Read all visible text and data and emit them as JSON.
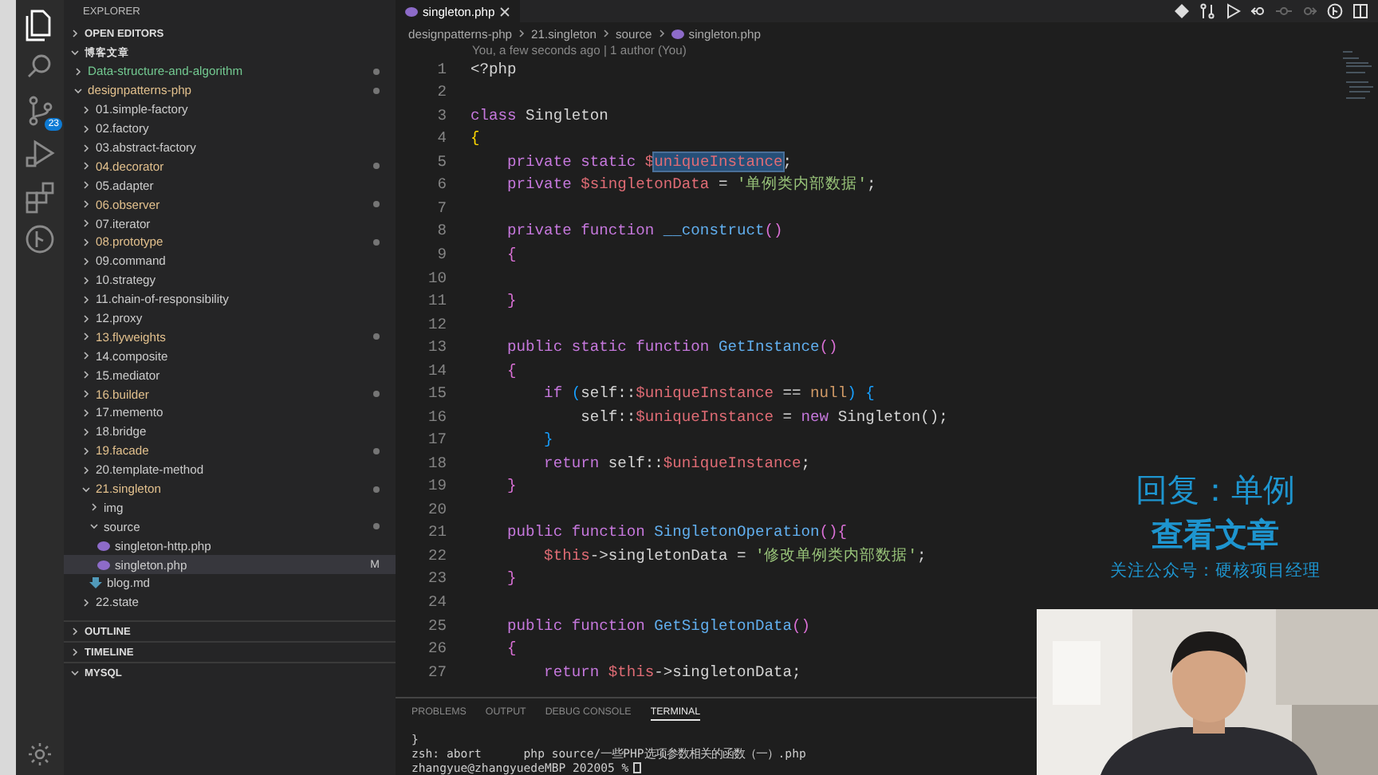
{
  "activity_bar": {
    "items": [
      {
        "kind": "files",
        "selected": true
      },
      {
        "kind": "search",
        "selected": false
      },
      {
        "kind": "source-control",
        "selected": false,
        "badge": "23"
      },
      {
        "kind": "run",
        "selected": false
      },
      {
        "kind": "extensions",
        "selected": false
      },
      {
        "kind": "git-graph",
        "selected": false
      }
    ]
  },
  "sidebar": {
    "title": "EXPLORER",
    "sections_top": [
      {
        "label": "OPEN EDITORS",
        "expanded": false
      }
    ],
    "workspace": {
      "label": "博客文章",
      "expanded": true
    },
    "tree": [
      {
        "label": "Data-structure-and-algorithm",
        "kind": "folder",
        "expanded": false,
        "color": "#73c991",
        "dot": true,
        "selected": false
      },
      {
        "label": "designpatterns-php",
        "kind": "folder",
        "expanded": true,
        "color": "#e2c08d",
        "dot": true,
        "selected": false,
        "children": [
          {
            "label": "01.simple-factory",
            "kind": "folder",
            "expanded": false,
            "color": "#cccccc",
            "dot": false,
            "selected": false
          },
          {
            "label": "02.factory",
            "kind": "folder",
            "expanded": false,
            "color": "#cccccc",
            "dot": false,
            "selected": false
          },
          {
            "label": "03.abstract-factory",
            "kind": "folder",
            "expanded": false,
            "color": "#cccccc",
            "dot": false,
            "selected": false
          },
          {
            "label": "04.decorator",
            "kind": "folder",
            "expanded": false,
            "color": "#e2c08d",
            "dot": true,
            "selected": false
          },
          {
            "label": "05.adapter",
            "kind": "folder",
            "expanded": false,
            "color": "#cccccc",
            "dot": false,
            "selected": false
          },
          {
            "label": "06.observer",
            "kind": "folder",
            "expanded": false,
            "color": "#e2c08d",
            "dot": true,
            "selected": false
          },
          {
            "label": "07.iterator",
            "kind": "folder",
            "expanded": false,
            "color": "#cccccc",
            "dot": false,
            "selected": false
          },
          {
            "label": "08.prototype",
            "kind": "folder",
            "expanded": false,
            "color": "#e2c08d",
            "dot": true,
            "selected": false
          },
          {
            "label": "09.command",
            "kind": "folder",
            "expanded": false,
            "color": "#cccccc",
            "dot": false,
            "selected": false
          },
          {
            "label": "10.strategy",
            "kind": "folder",
            "expanded": false,
            "color": "#cccccc",
            "dot": false,
            "selected": false
          },
          {
            "label": "11.chain-of-responsibility",
            "kind": "folder",
            "expanded": false,
            "color": "#cccccc",
            "dot": false,
            "selected": false
          },
          {
            "label": "12.proxy",
            "kind": "folder",
            "expanded": false,
            "color": "#cccccc",
            "dot": false,
            "selected": false
          },
          {
            "label": "13.flyweights",
            "kind": "folder",
            "expanded": false,
            "color": "#e2c08d",
            "dot": true,
            "selected": false
          },
          {
            "label": "14.composite",
            "kind": "folder",
            "expanded": false,
            "color": "#cccccc",
            "dot": false,
            "selected": false
          },
          {
            "label": "15.mediator",
            "kind": "folder",
            "expanded": false,
            "color": "#cccccc",
            "dot": false,
            "selected": false
          },
          {
            "label": "16.builder",
            "kind": "folder",
            "expanded": false,
            "color": "#e2c08d",
            "dot": true,
            "selected": false
          },
          {
            "label": "17.memento",
            "kind": "folder",
            "expanded": false,
            "color": "#cccccc",
            "dot": false,
            "selected": false
          },
          {
            "label": "18.bridge",
            "kind": "folder",
            "expanded": false,
            "color": "#cccccc",
            "dot": false,
            "selected": false
          },
          {
            "label": "19.facade",
            "kind": "folder",
            "expanded": false,
            "color": "#e2c08d",
            "dot": true,
            "selected": false
          },
          {
            "label": "20.template-method",
            "kind": "folder",
            "expanded": false,
            "color": "#cccccc",
            "dot": false,
            "selected": false
          },
          {
            "label": "21.singleton",
            "kind": "folder",
            "expanded": true,
            "color": "#e2c08d",
            "dot": true,
            "selected": false,
            "children": [
              {
                "label": "img",
                "kind": "folder",
                "expanded": false,
                "color": "#cccccc",
                "dot": false,
                "selected": false
              },
              {
                "label": "source",
                "kind": "folder",
                "expanded": true,
                "color": "#cccccc",
                "dot": true,
                "selected": false,
                "children": [
                  {
                    "label": "singleton-http.php",
                    "kind": "php_file",
                    "color": "#cccccc",
                    "dot": false,
                    "selected": false
                  },
                  {
                    "label": "singleton.php",
                    "kind": "php_file",
                    "color": "#cccccc",
                    "badge": "M",
                    "selected": true
                  }
                ]
              },
              {
                "label": "blog.md",
                "kind": "md_file",
                "color": "#cccccc",
                "dot": false,
                "selected": false
              }
            ]
          },
          {
            "label": "22.state",
            "kind": "folder",
            "expanded": false,
            "color": "#cccccc",
            "dot": false,
            "selected": false
          }
        ]
      }
    ],
    "sections_bottom": [
      {
        "label": "OUTLINE",
        "expanded": false
      },
      {
        "label": "TIMELINE",
        "expanded": false
      },
      {
        "label": "MYSQL",
        "expanded": true
      }
    ]
  },
  "editor": {
    "tabs": [
      {
        "label": "singleton.php",
        "selected": true
      }
    ],
    "breadcrumbs": [
      "designpatterns-php",
      "21.singleton",
      "source",
      "singleton.php"
    ],
    "blame": "You, a few seconds ago | 1 author (You)",
    "lines": [
      {
        "number": "1",
        "tokens": [
          {
            "text": "<?php",
            "kind": "plain"
          }
        ]
      },
      {
        "number": "2"
      },
      {
        "number": "3",
        "tokens": [
          {
            "text": "class",
            "kind": "keyword"
          },
          {
            "text": " Singleton",
            "kind": "plain"
          }
        ]
      },
      {
        "number": "4",
        "tokens": [
          {
            "text": "{",
            "kind": "brace"
          }
        ]
      },
      {
        "number": "5",
        "tokens": [
          {
            "text": "    private static ",
            "kind": "keyword"
          },
          {
            "text": "$",
            "kind": "variable"
          },
          {
            "text": "uniqueInstance",
            "kind": "variable",
            "highlight": true
          },
          {
            "text": ";",
            "kind": "plain"
          }
        ]
      },
      {
        "number": "6",
        "tokens": [
          {
            "text": "    private ",
            "kind": "keyword"
          },
          {
            "text": "$singletonData",
            "kind": "variable"
          },
          {
            "text": " = ",
            "kind": "plain"
          },
          {
            "text": "'单例类内部数据'",
            "kind": "string"
          },
          {
            "text": ";",
            "kind": "plain"
          }
        ]
      },
      {
        "number": "7"
      },
      {
        "number": "8",
        "tokens": [
          {
            "text": "    private function ",
            "kind": "keyword"
          },
          {
            "text": "__construct",
            "kind": "function"
          },
          {
            "text": "()",
            "kind": "brace2"
          }
        ]
      },
      {
        "number": "9",
        "tokens": [
          {
            "text": "    {",
            "kind": "brace2"
          }
        ]
      },
      {
        "number": "10"
      },
      {
        "number": "11",
        "tokens": [
          {
            "text": "    }",
            "kind": "brace2"
          }
        ]
      },
      {
        "number": "12"
      },
      {
        "number": "13",
        "tokens": [
          {
            "text": "    public static function ",
            "kind": "keyword"
          },
          {
            "text": "GetInstance",
            "kind": "function"
          },
          {
            "text": "()",
            "kind": "brace2"
          }
        ]
      },
      {
        "number": "14",
        "tokens": [
          {
            "text": "    {",
            "kind": "brace2"
          }
        ]
      },
      {
        "number": "15",
        "tokens": [
          {
            "text": "        if ",
            "kind": "keyword"
          },
          {
            "text": "(",
            "kind": "brace3"
          },
          {
            "text": "self::",
            "kind": "plain"
          },
          {
            "text": "$uniqueInstance",
            "kind": "variable"
          },
          {
            "text": " == ",
            "kind": "plain"
          },
          {
            "text": "null",
            "kind": "constant"
          },
          {
            "text": ") {",
            "kind": "brace3"
          }
        ]
      },
      {
        "number": "16",
        "tokens": [
          {
            "text": "            self::",
            "kind": "plain"
          },
          {
            "text": "$uniqueInstance",
            "kind": "variable"
          },
          {
            "text": " = ",
            "kind": "plain"
          },
          {
            "text": "new ",
            "kind": "keyword"
          },
          {
            "text": "Singleton",
            "kind": "plain"
          },
          {
            "text": "();",
            "kind": "plain"
          }
        ]
      },
      {
        "number": "17",
        "tokens": [
          {
            "text": "        }",
            "kind": "brace3"
          }
        ]
      },
      {
        "number": "18",
        "tokens": [
          {
            "text": "        return ",
            "kind": "keyword"
          },
          {
            "text": "self::",
            "kind": "plain"
          },
          {
            "text": "$uniqueInstance",
            "kind": "variable"
          },
          {
            "text": ";",
            "kind": "plain"
          }
        ]
      },
      {
        "number": "19",
        "tokens": [
          {
            "text": "    }",
            "kind": "brace2"
          }
        ]
      },
      {
        "number": "20"
      },
      {
        "number": "21",
        "tokens": [
          {
            "text": "    public function ",
            "kind": "keyword"
          },
          {
            "text": "SingletonOperation",
            "kind": "function"
          },
          {
            "text": "(){",
            "kind": "brace2"
          }
        ]
      },
      {
        "number": "22",
        "tokens": [
          {
            "text": "        $this",
            "kind": "variable"
          },
          {
            "text": "->",
            "kind": "plain"
          },
          {
            "text": "singletonData",
            "kind": "plain"
          },
          {
            "text": " = ",
            "kind": "plain"
          },
          {
            "text": "'修改单例类内部数据'",
            "kind": "string"
          },
          {
            "text": ";",
            "kind": "plain"
          }
        ]
      },
      {
        "number": "23",
        "tokens": [
          {
            "text": "    }",
            "kind": "brace2"
          }
        ]
      },
      {
        "number": "24"
      },
      {
        "number": "25",
        "tokens": [
          {
            "text": "    public function ",
            "kind": "keyword"
          },
          {
            "text": "GetSigletonData",
            "kind": "function"
          },
          {
            "text": "()",
            "kind": "brace2"
          }
        ]
      },
      {
        "number": "26",
        "tokens": [
          {
            "text": "    {",
            "kind": "brace2"
          }
        ]
      },
      {
        "number": "27",
        "tokens": [
          {
            "text": "        return ",
            "kind": "keyword"
          },
          {
            "text": "$this",
            "kind": "variable"
          },
          {
            "text": "->",
            "kind": "plain"
          },
          {
            "text": "singletonData",
            "kind": "plain"
          },
          {
            "text": ";",
            "kind": "plain"
          }
        ]
      }
    ]
  },
  "panel": {
    "tabs": [
      {
        "label": "PROBLEMS",
        "selected": false
      },
      {
        "label": "OUTPUT",
        "selected": false
      },
      {
        "label": "DEBUG CONSOLE",
        "selected": false
      },
      {
        "label": "TERMINAL",
        "selected": true
      }
    ],
    "terminal_lines": [
      "}",
      "zsh: abort      php source/一些PHP选项参数相关的函数（一）.php",
      "zhangyue@zhangyuedeMBP 202005 %"
    ]
  },
  "overlay": {
    "title": "回复：单例",
    "subtitle": "查看文章",
    "caption": "关注公众号：硬核项目经理"
  }
}
